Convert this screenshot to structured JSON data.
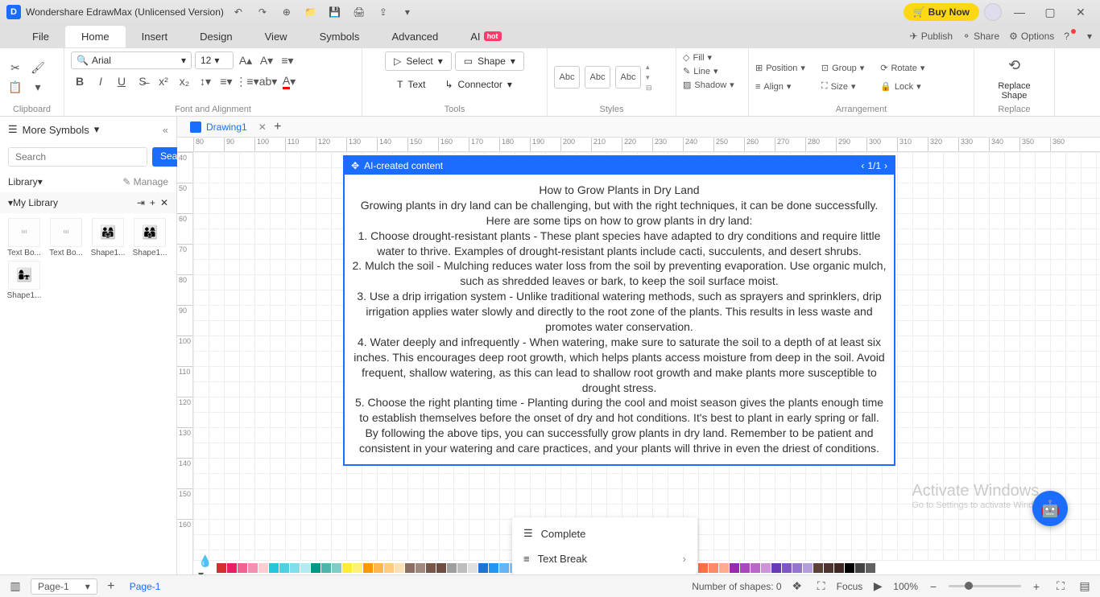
{
  "app": {
    "title": "Wondershare EdrawMax (Unlicensed Version)",
    "buyNow": "Buy Now"
  },
  "menu": {
    "file": "File",
    "home": "Home",
    "insert": "Insert",
    "design": "Design",
    "view": "View",
    "symbols": "Symbols",
    "advanced": "Advanced",
    "ai": "AI",
    "hot": "hot",
    "publish": "Publish",
    "share": "Share",
    "options": "Options"
  },
  "ribbon": {
    "clipboard": "Clipboard",
    "fontAlign": "Font and Alignment",
    "tools": "Tools",
    "styles": "Styles",
    "arrangement": "Arrangement",
    "replace": "Replace",
    "fontName": "Arial",
    "fontSize": "12",
    "select": "Select",
    "shape": "Shape",
    "text": "Text",
    "connector": "Connector",
    "abc": "Abc",
    "fill": "Fill",
    "line": "Line",
    "shadow": "Shadow",
    "position": "Position",
    "align": "Align",
    "group": "Group",
    "size": "Size",
    "rotate": "Rotate",
    "lock": "Lock",
    "replaceShape": "Replace\nShape"
  },
  "sidebar": {
    "moreSymbols": "More Symbols",
    "searchPlaceholder": "Search",
    "searchBtn": "Search",
    "library": "Library",
    "manage": "Manage",
    "myLibrary": "My Library",
    "items": [
      {
        "label": "Text Bo..."
      },
      {
        "label": "Text Bo..."
      },
      {
        "label": "Shape1..."
      },
      {
        "label": "Shape1..."
      },
      {
        "label": "Shape1..."
      }
    ]
  },
  "doc": {
    "tabName": "Drawing1"
  },
  "rulerH": [
    "80",
    "90",
    "100",
    "110",
    "120",
    "130",
    "140",
    "150",
    "160",
    "170",
    "180",
    "190",
    "200",
    "210",
    "220",
    "230",
    "240",
    "250",
    "260",
    "270",
    "280",
    "290",
    "300",
    "310",
    "320",
    "330",
    "340",
    "350",
    "360"
  ],
  "rulerV": [
    "40",
    "50",
    "60",
    "70",
    "80",
    "90",
    "100",
    "110",
    "120",
    "130",
    "140",
    "150",
    "160"
  ],
  "aiBox": {
    "header": "AI-created content",
    "nav": "1/1",
    "lines": [
      "How to Grow Plants in Dry Land",
      "Growing plants in dry land can be challenging, but with the right techniques, it can be done successfully. Here are some tips on how to grow plants in dry land:",
      "1. Choose drought-resistant plants - These plant species have adapted to dry conditions and require little water to thrive. Examples of drought-resistant plants include cacti, succulents, and desert shrubs.",
      "2. Mulch the soil - Mulching reduces water loss from the soil by preventing evaporation. Use organic mulch, such as shredded leaves or bark, to keep the soil surface moist.",
      "3. Use a drip irrigation system - Unlike traditional watering methods, such as sprayers and sprinklers, drip irrigation applies water slowly and directly to the root zone of the plants. This results in less waste and promotes water conservation.",
      "4. Water deeply and infrequently - When watering, make sure to saturate the soil to a depth of at least six inches. This encourages deep root growth, which helps plants access moisture from deep in the soil. Avoid frequent, shallow watering, as this can lead to shallow root growth and make plants more susceptible to drought stress.",
      "5. Choose the right planting time - Planting during the cool and moist season gives the plants enough time to establish themselves before the onset of dry and hot conditions. It's best to plant in early spring or fall.",
      "By following the above tips, you can successfully grow plants in dry land. Remember to be patient and consistent in your watering and care practices, and your plants will thrive in even the driest of conditions."
    ]
  },
  "context": {
    "complete": "Complete",
    "textBreak": "Text Break"
  },
  "watermark": {
    "title": "Activate Windows",
    "sub": "Go to Settings to activate Windows."
  },
  "status": {
    "page": "Page-1",
    "pageTab": "Page-1",
    "shapes": "Number of shapes: 0",
    "focus": "Focus",
    "zoom": "100%"
  },
  "colors": [
    "#d32f2f",
    "#e91e63",
    "#f06292",
    "#f48fb1",
    "#ffcdd2",
    "#26c6da",
    "#4dd0e1",
    "#80deea",
    "#b2ebf2",
    "#009688",
    "#4db6ac",
    "#80cbc4",
    "#ffeb3b",
    "#fff176",
    "#ff9800",
    "#ffb74d",
    "#ffcc80",
    "#ffe0b2",
    "#8d6e63",
    "#a1887f",
    "#795548",
    "#6d4c41",
    "#9e9e9e",
    "#bdbdbd",
    "#e0e0e0",
    "#1976d2",
    "#2196f3",
    "#64b5f6",
    "#90caf9",
    "#3f51b5",
    "#5c6bc0",
    "#7986cb",
    "#4caf50",
    "#66bb6a",
    "#81c784",
    "#a5d6a7",
    "#8bc34a",
    "#aed581",
    "#c5e1a5",
    "#cddc39",
    "#dce775",
    "#607d8b",
    "#78909c",
    "#90a4ae",
    "#b0bec5",
    "#ff5722",
    "#ff7043",
    "#ff8a65",
    "#ffab91",
    "#9c27b0",
    "#ab47bc",
    "#ba68c8",
    "#ce93d8",
    "#673ab7",
    "#7e57c2",
    "#9575cd",
    "#b39ddb",
    "#5d4037",
    "#4e342e",
    "#3e2723",
    "#000000",
    "#424242",
    "#616161"
  ]
}
